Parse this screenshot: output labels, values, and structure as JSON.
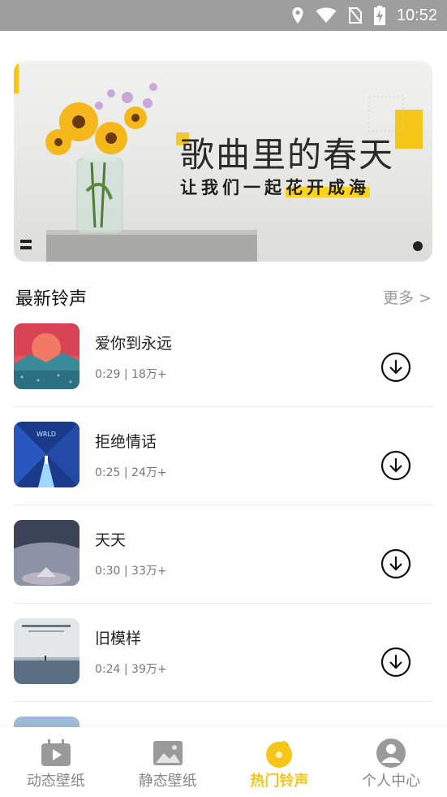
{
  "status": {
    "time": "10:52"
  },
  "banner": {
    "title": "歌曲里的春天",
    "subtitle_part1": "让我们一起",
    "subtitle_part2": "花开成海"
  },
  "section": {
    "title": "最新铃声",
    "more": "更多 >"
  },
  "ringtones": [
    {
      "name": "爱你到永远",
      "meta": "0:29 | 18万+"
    },
    {
      "name": "拒绝情话",
      "meta": "0:25 | 24万+"
    },
    {
      "name": "天天",
      "meta": "0:30 | 33万+"
    },
    {
      "name": "旧模样",
      "meta": "0:24 | 39万+"
    },
    {
      "name": "",
      "meta": ""
    }
  ],
  "nav": [
    {
      "label": "动态壁纸",
      "icon": "video-icon"
    },
    {
      "label": "静态壁纸",
      "icon": "image-icon"
    },
    {
      "label": "热门铃声",
      "icon": "music-disc-icon",
      "active": true
    },
    {
      "label": "个人中心",
      "icon": "user-icon"
    }
  ],
  "colors": {
    "accent": "#f5c518",
    "status_bar": "#9e9e9e"
  }
}
